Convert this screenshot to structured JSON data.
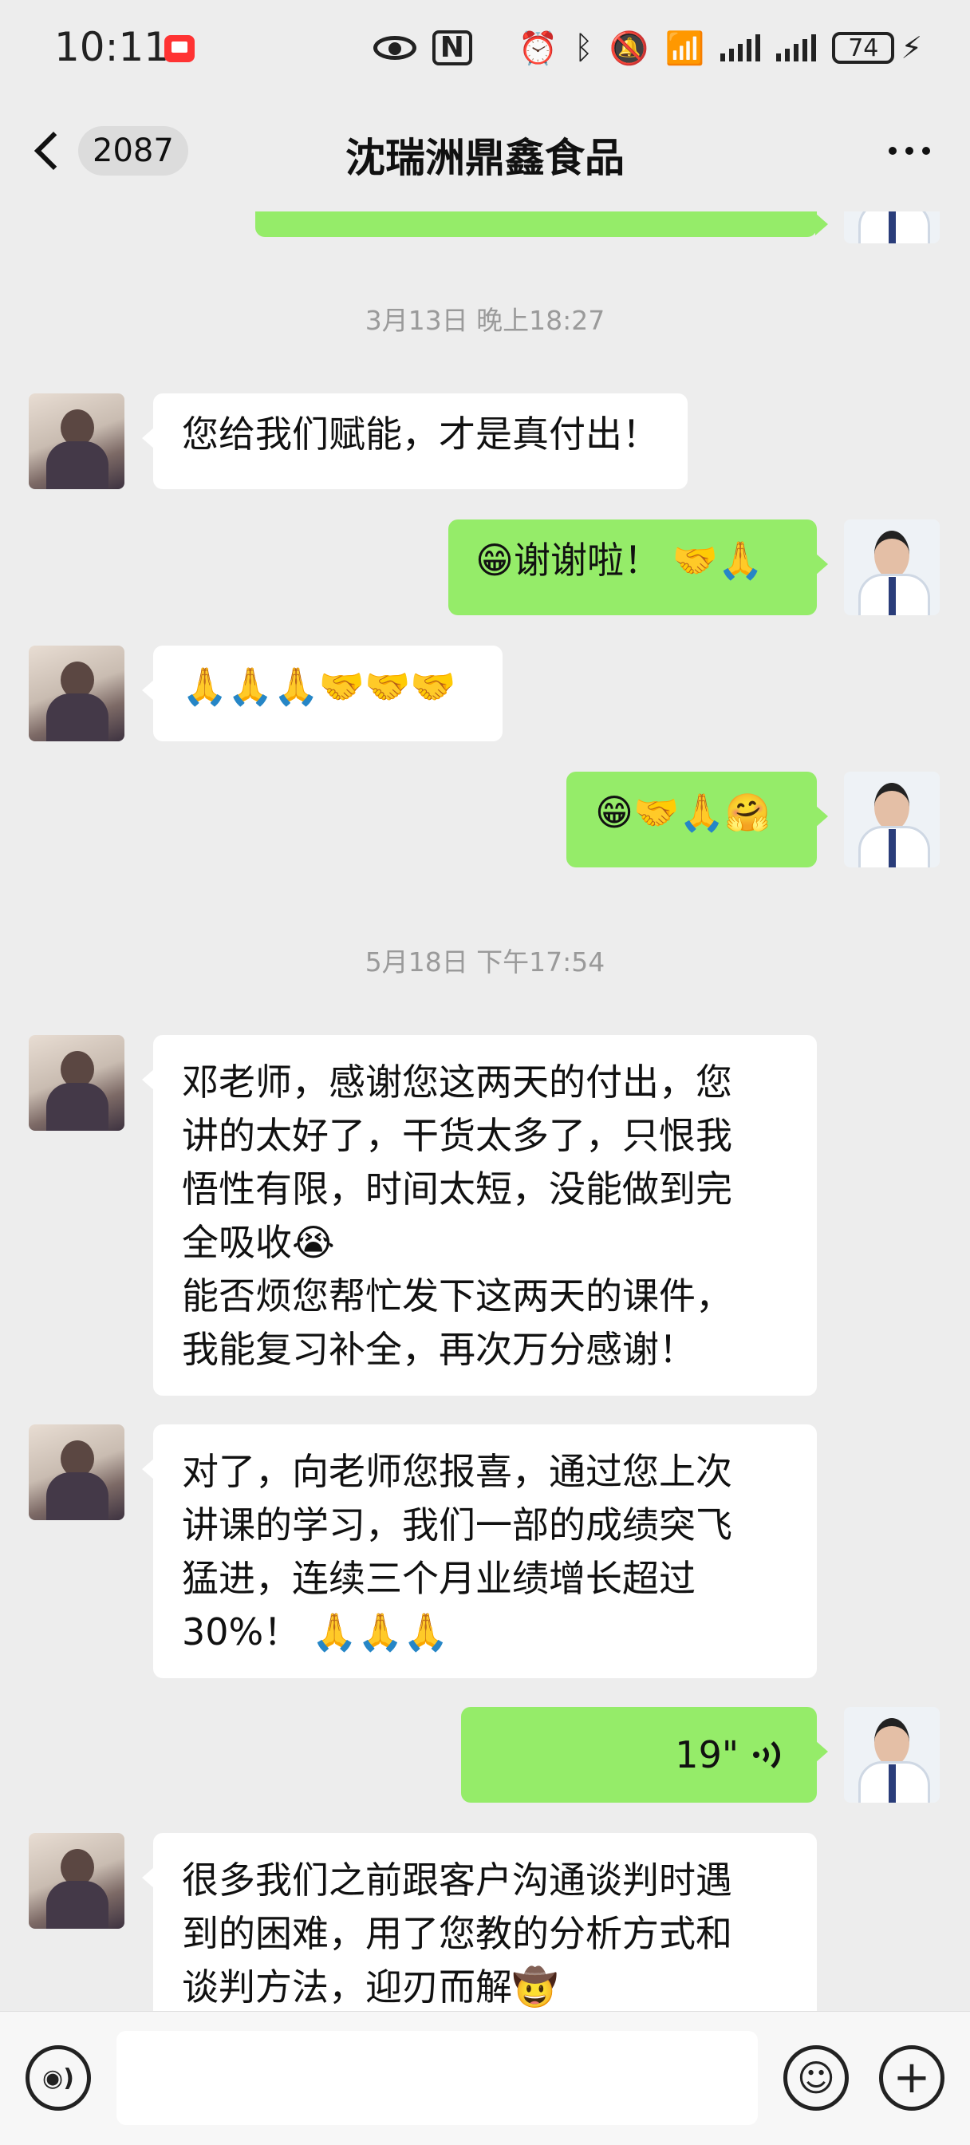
{
  "status_bar": {
    "time": "10:11",
    "nfc_label": "N",
    "battery": "74"
  },
  "header": {
    "unread_count": "2087",
    "title": "沈瑞洲鼎鑫食品"
  },
  "messages": [
    {
      "type": "timestamp",
      "text": "3月13日 晚上18:27"
    },
    {
      "type": "text",
      "side": "left",
      "lines": [
        "您给我们赋能，才是真付出！"
      ]
    },
    {
      "type": "text",
      "side": "right",
      "lines": [
        "😁谢谢啦！ 🤝🙏"
      ]
    },
    {
      "type": "text",
      "side": "left",
      "lines": [
        "🙏🙏🙏🤝🤝🤝"
      ]
    },
    {
      "type": "text",
      "side": "right",
      "lines": [
        "😁🤝🙏🤗"
      ]
    },
    {
      "type": "timestamp",
      "text": "5月18日 下午17:54"
    },
    {
      "type": "text",
      "side": "left",
      "lines": [
        "邓老师，感谢您这两天的付出，您",
        "讲的太好了，干货太多了，只恨我",
        "悟性有限，时间太短，没能做到完",
        "全吸收😭",
        "能否烦您帮忙发下这两天的课件，",
        "我能复习补全，再次万分感谢！"
      ]
    },
    {
      "type": "text",
      "side": "left",
      "lines": [
        "对了，向老师您报喜，通过您上次",
        "讲课的学习，我们一部的成绩突飞",
        "猛进，连续三个月业绩增长超过",
        "30%！ 🙏🙏🙏"
      ]
    },
    {
      "type": "voice",
      "side": "right",
      "duration": "19\""
    },
    {
      "type": "text",
      "side": "left",
      "lines": [
        "很多我们之前跟客户沟通谈判时遇",
        "到的困难，用了您教的分析方式和",
        "谈判方法，迎刃而解🤠"
      ]
    }
  ],
  "input_bar": {
    "voice_icon": "voice-input-icon",
    "emoji_icon": "emoji-icon",
    "plus_icon": "plus-icon",
    "placeholder": ""
  },
  "colors": {
    "background": "#ededed",
    "bubble_self": "#95ec69",
    "bubble_other": "#ffffff",
    "timestamp_text": "#9a9a9a"
  }
}
